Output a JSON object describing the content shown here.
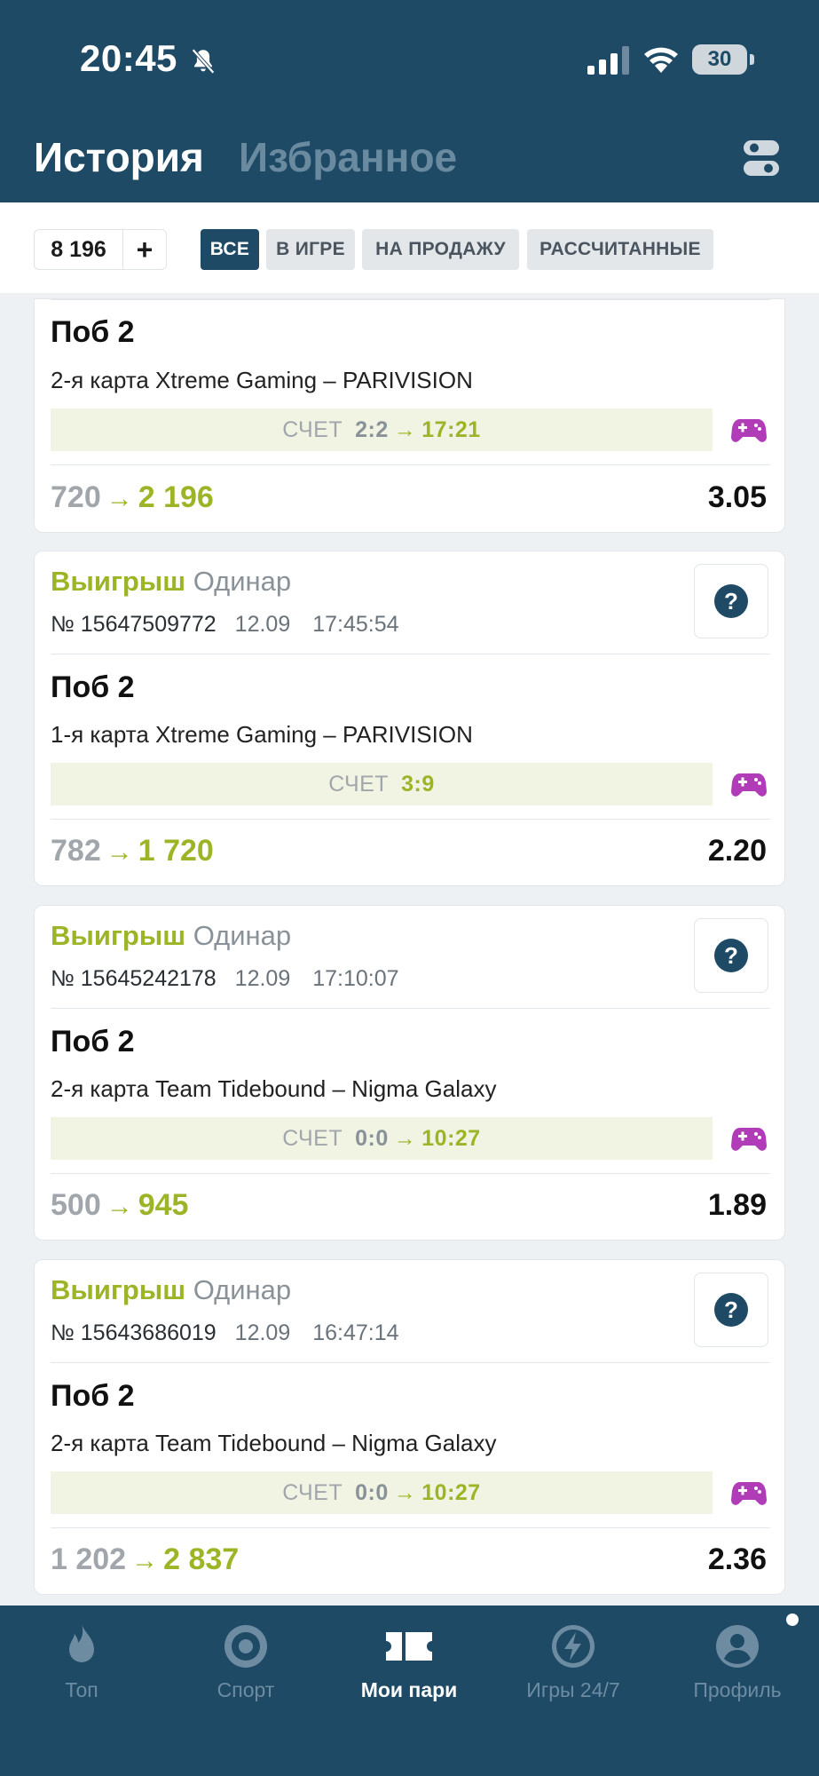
{
  "status_bar": {
    "time": "20:45",
    "battery": "30"
  },
  "header": {
    "tabs": [
      "История",
      "Избранное"
    ]
  },
  "filters": {
    "count": "8 196",
    "plus": "+",
    "chips": [
      "ВСЕ",
      "В ИГРЕ",
      "НА ПРОДАЖУ",
      "РАССЧИТАННЫЕ"
    ]
  },
  "cards": [
    {
      "bet_name": "Поб 2",
      "event": "2-я карта Xtreme Gaming – PARIVISION",
      "score_label": "СЧЕТ",
      "score": "2:2",
      "score_time": "17:21",
      "stake": "720",
      "win": "2 196",
      "odds": "3.05"
    },
    {
      "status": "Выигрыш",
      "type": "Одинар",
      "number": "№ 15647509772",
      "date": "12.09",
      "time": "17:45:54",
      "bet_name": "Поб 2",
      "event": "1-я карта Xtreme Gaming – PARIVISION",
      "score_label": "СЧЕТ",
      "score": "3:9",
      "stake": "782",
      "win": "1 720",
      "odds": "2.20"
    },
    {
      "status": "Выигрыш",
      "type": "Одинар",
      "number": "№ 15645242178",
      "date": "12.09",
      "time": "17:10:07",
      "bet_name": "Поб 2",
      "event": "2-я карта Team Tidebound – Nigma Galaxy",
      "score_label": "СЧЕТ",
      "score": "0:0",
      "score_time": "10:27",
      "stake": "500",
      "win": "945",
      "odds": "1.89"
    },
    {
      "status": "Выигрыш",
      "type": "Одинар",
      "number": "№ 15643686019",
      "date": "12.09",
      "time": "16:47:14",
      "bet_name": "Поб 2",
      "event": "2-я карта Team Tidebound – Nigma Galaxy",
      "score_label": "СЧЕТ",
      "score": "0:0",
      "score_time": "10:27",
      "stake": "1 202",
      "win": "2 837",
      "odds": "2.36"
    }
  ],
  "arrow": "→",
  "help": "?",
  "bottom_nav": [
    {
      "label": "Топ",
      "icon": "flame-icon"
    },
    {
      "label": "Спорт",
      "icon": "sport-target-icon"
    },
    {
      "label": "Мои пари",
      "icon": "ticket-icon",
      "active": true
    },
    {
      "label": "Игры 24/7",
      "icon": "lightning-icon"
    },
    {
      "label": "Профиль",
      "icon": "profile-icon"
    }
  ],
  "colors": {
    "header": "#1e4a66",
    "win_green": "#9bb527",
    "gamepad": "#b03cb8"
  }
}
